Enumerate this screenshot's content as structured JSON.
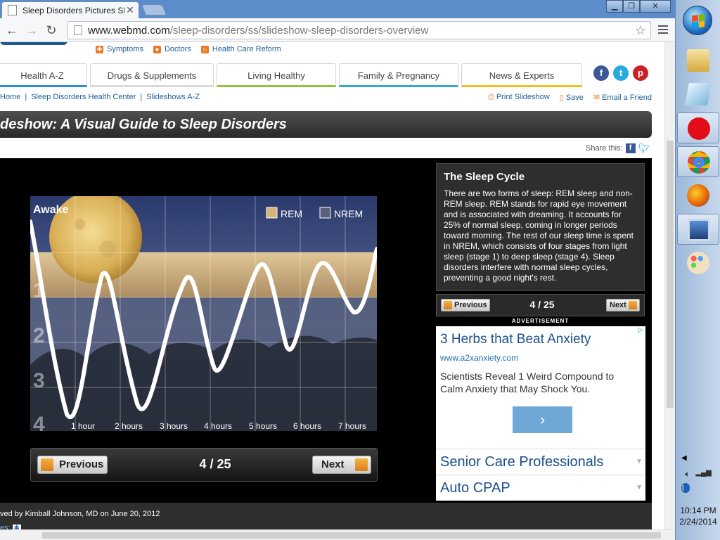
{
  "browser": {
    "tab_title": "Sleep Disorders Pictures Sl",
    "url_domain": "www.webmd.com",
    "url_path": "/sleep-disorders/ss/slideshow-sleep-disorders-overview"
  },
  "header": {
    "top_links": [
      "Symptoms",
      "Doctors",
      "Health Care Reform"
    ],
    "nav_tabs": [
      "Health A-Z",
      "Drugs & Supplements",
      "Living Healthy",
      "Family & Pregnancy",
      "News & Experts"
    ],
    "social": [
      "f",
      "t",
      "p"
    ]
  },
  "breadcrumb": [
    "Home",
    "Sleep Disorders Health Center",
    "Slideshows A-Z"
  ],
  "page_actions": [
    "Print Slideshow",
    "Save",
    "Email a Friend"
  ],
  "slideshow": {
    "title": "deshow: A Visual Guide to Sleep Disorders",
    "share_label": "Share this:",
    "counter": "4 / 25",
    "prev_label": "Previous",
    "next_label": "Next"
  },
  "slide_chart": {
    "awake_label": "Awake",
    "legend": [
      "REM",
      "NREM"
    ],
    "stage_labels": [
      "1",
      "2",
      "3",
      "4"
    ],
    "x_labels": [
      "1 hour",
      "2 hours",
      "3 hours",
      "4 hours",
      "5 hours",
      "6 hours",
      "7 hours"
    ],
    "colors": {
      "rem": "#d9b47a",
      "nrem": "#5a5f7a",
      "curve": "#ffffff"
    }
  },
  "caption": {
    "heading": "The Sleep Cycle",
    "body": "There are two forms of sleep: REM sleep and non-REM sleep. REM stands for rapid eye movement and is associated with dreaming. It accounts for 25% of normal sleep, coming in longer periods toward morning. The rest of our sleep time is spent in NREM, which consists of four stages from light sleep (stage 1) to deep sleep (stage 4). Sleep disorders interfere with normal sleep cycles, preventing a good night's rest."
  },
  "ad": {
    "label": "ADVERTISEMENT",
    "headline": "3 Herbs that Beat Anxiety",
    "url": "www.a2xanxiety.com",
    "description": "Scientists Reveal 1 Weird Compound to Calm Anxiety that May Shock You.",
    "go": "›",
    "links": [
      "Senior Care Professionals",
      "Auto CPAP"
    ]
  },
  "footer": {
    "reviewed": "ved by Kimball Johnson, MD on June 20, 2012",
    "tags": "es:"
  },
  "taskbar": {
    "time": "10:14 PM",
    "date": "2/24/2014"
  }
}
